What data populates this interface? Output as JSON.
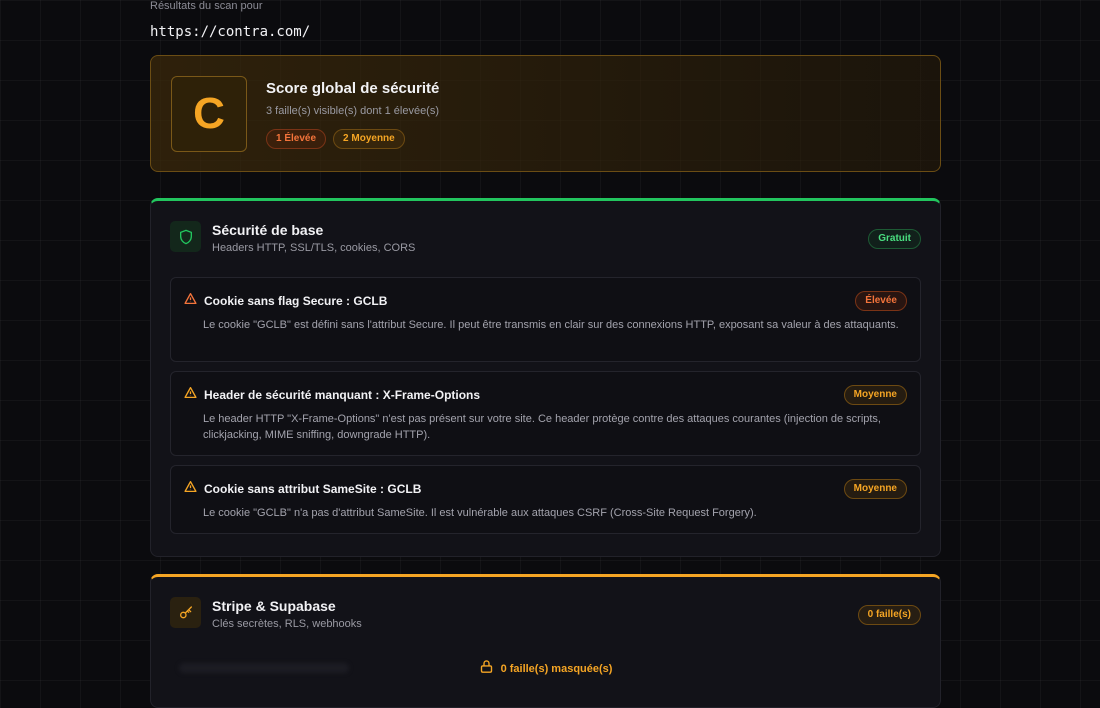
{
  "scan": {
    "label": "Résultats du scan pour",
    "url": "https://contra.com/"
  },
  "score": {
    "grade": "C",
    "title": "Score global de sécurité",
    "subtitle": "3 faille(s) visible(s) dont 1 élevée(s)",
    "pills": [
      "1 Élevée",
      "2 Moyenne"
    ]
  },
  "sections": [
    {
      "icon": "shield-icon",
      "title": "Sécurité de base",
      "subtitle": "Headers HTTP, SSL/TLS, cookies, CORS",
      "badge": "Gratuit",
      "accent": "#22c55e",
      "findings": [
        {
          "title": "Cookie sans flag Secure : GCLB",
          "severity": "Élevée",
          "description": "Le cookie \"GCLB\" est défini sans l'attribut Secure. Il peut être transmis en clair sur des connexions HTTP, exposant sa valeur à des attaquants."
        },
        {
          "title": "Header de sécurité manquant : X-Frame-Options",
          "severity": "Moyenne",
          "description": "Le header HTTP \"X-Frame-Options\" n'est pas présent sur votre site. Ce header protège contre des attaques courantes (injection de scripts, clickjacking, MIME sniffing, downgrade HTTP)."
        },
        {
          "title": "Cookie sans attribut SameSite : GCLB",
          "severity": "Moyenne",
          "description": "Le cookie \"GCLB\" n'a pas d'attribut SameSite. Il est vulnérable aux attaques CSRF (Cross-Site Request Forgery)."
        }
      ]
    },
    {
      "icon": "key-icon",
      "title": "Stripe & Supabase",
      "subtitle": "Clés secrètes, RLS, webhooks",
      "badge": "0 faille(s)",
      "accent": "#f5a524",
      "masked": "0 faille(s) masquée(s)"
    }
  ],
  "colors": {
    "high": "#f4743b",
    "medium": "#f5a524",
    "success": "#22c55e"
  }
}
